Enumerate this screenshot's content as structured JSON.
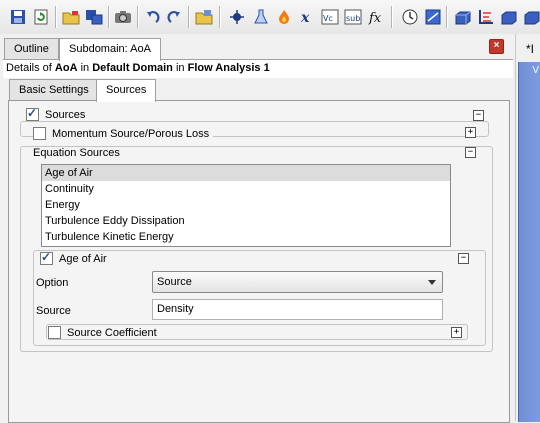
{
  "toolbar": {
    "buttons": [
      {
        "icon": "save-icon"
      },
      {
        "icon": "refresh-icon"
      },
      {
        "icon": "open-folder-icon"
      },
      {
        "icon": "save-as-icon"
      },
      {
        "icon": "camera-icon"
      },
      {
        "icon": "undo-icon"
      },
      {
        "icon": "redo-icon"
      },
      {
        "icon": "import-folder-icon"
      },
      {
        "icon": "location-icon"
      },
      {
        "icon": "material-flask-icon"
      },
      {
        "icon": "flame-icon"
      },
      {
        "icon": "variable-icon"
      },
      {
        "icon": "vector-icon"
      },
      {
        "icon": "subdomain-icon"
      },
      {
        "icon": "function-icon"
      },
      {
        "icon": "clock-icon"
      },
      {
        "icon": "solver-icon"
      },
      {
        "icon": "domain-box-icon"
      },
      {
        "icon": "axis-icon"
      },
      {
        "icon": "box-icon"
      }
    ]
  },
  "tabs": {
    "outline": "Outline",
    "subdomain": "Subdomain: AoA"
  },
  "right_panel": {
    "tab_label": "*I",
    "scroll_label": "V"
  },
  "details": {
    "prefix": "Details of",
    "object": "AoA",
    "in1": "in",
    "domain": "Default Domain",
    "in2": "in",
    "analysis": "Flow Analysis 1"
  },
  "subtabs": {
    "basic": "Basic Settings",
    "sources": "Sources"
  },
  "sources": {
    "label": "Sources",
    "checked": true,
    "momentum": {
      "label": "Momentum Source/Porous Loss",
      "checked": false
    },
    "equation_sources": {
      "label": "Equation Sources",
      "items": [
        "Age of Air",
        "Continuity",
        "Energy",
        "Turbulence Eddy Dissipation",
        "Turbulence Kinetic Energy"
      ],
      "selected_index": 0
    },
    "age_of_air": {
      "label": "Age of Air",
      "checked": true,
      "option_label": "Option",
      "option_value": "Source",
      "source_label": "Source",
      "source_value": "Density",
      "coefficient": {
        "label": "Source Coefficient",
        "checked": false
      }
    }
  },
  "colors": {
    "accent_blue": "#7f9de0",
    "close_red": "#c0392b",
    "selection": "#dcdcdc"
  }
}
